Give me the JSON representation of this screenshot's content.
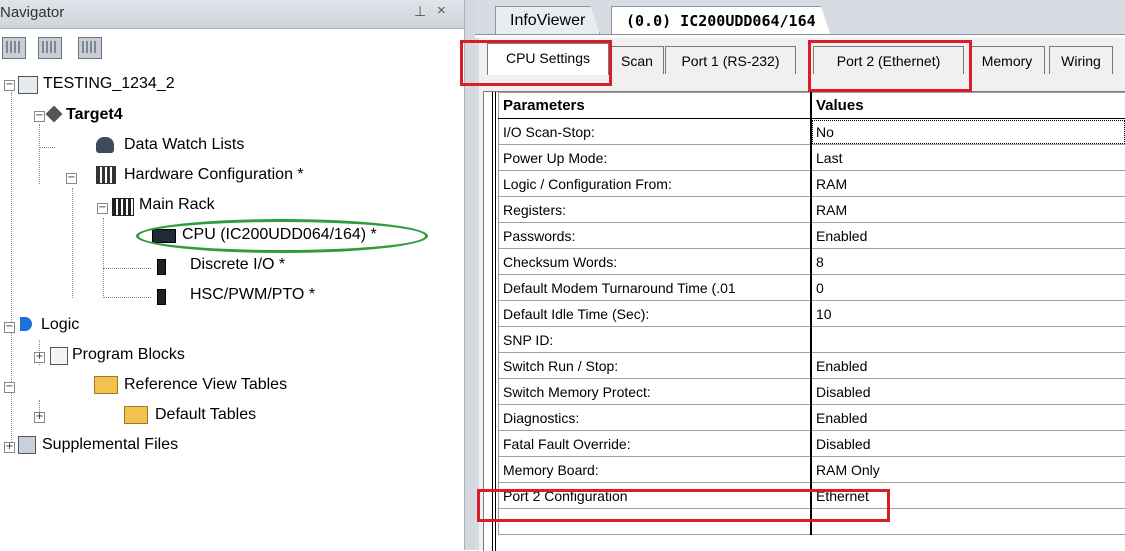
{
  "navigator": {
    "title": "Navigator",
    "pin_glyph": "⊥",
    "close_glyph": "×",
    "tree": {
      "root": "TESTING_1234_2",
      "target": "Target4",
      "data_watch": "Data Watch Lists",
      "hw_config": "Hardware Configuration *",
      "main_rack": "Main Rack",
      "cpu": "CPU (IC200UDD064/164) *",
      "discrete_io": "Discrete I/O *",
      "hsc": "HSC/PWM/PTO *",
      "logic": "Logic",
      "program_blocks": "Program Blocks",
      "ref_view_tables": "Reference View Tables",
      "default_tables": "Default Tables",
      "supplemental": "Supplemental Files"
    }
  },
  "editor": {
    "doc_tabs": [
      "InfoViewer",
      "(0.0) IC200UDD064/164"
    ],
    "sub_tabs": [
      "CPU Settings",
      "Scan",
      "Port 1 (RS-232)",
      "Port 2 (Ethernet)",
      "Memory",
      "Wiring"
    ],
    "grid": {
      "headers": [
        "Parameters",
        "Values"
      ],
      "rows": [
        [
          "I/O Scan-Stop:",
          "No"
        ],
        [
          "Power Up Mode:",
          "Last"
        ],
        [
          "Logic / Configuration From:",
          "RAM"
        ],
        [
          "Registers:",
          "RAM"
        ],
        [
          "Passwords:",
          "Enabled"
        ],
        [
          "Checksum Words:",
          "8"
        ],
        [
          "Default Modem Turnaround Time (.01",
          "0"
        ],
        [
          "Default Idle Time (Sec):",
          "10"
        ],
        [
          "SNP ID:",
          ""
        ],
        [
          "Switch Run / Stop:",
          "Enabled"
        ],
        [
          "Switch Memory Protect:",
          "Disabled"
        ],
        [
          "Diagnostics:",
          "Enabled"
        ],
        [
          "Fatal Fault Override:",
          "Disabled"
        ],
        [
          "Memory Board:",
          "RAM Only"
        ],
        [
          "Port 2 Configuration",
          "Ethernet"
        ],
        [
          "",
          ""
        ]
      ]
    }
  },
  "colors": {
    "highlight_red": "#d81e2c",
    "highlight_green": "#2f9e3a"
  }
}
